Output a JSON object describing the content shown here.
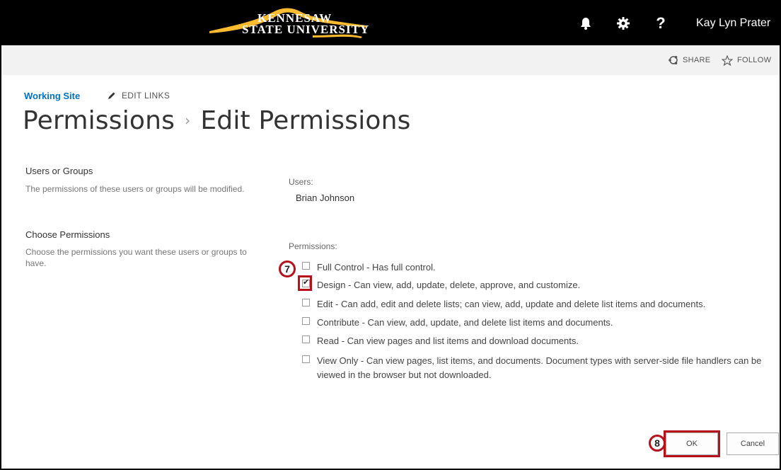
{
  "header": {
    "logo_line1": "KENNESAW",
    "logo_line2": "STATE UNIVERSITY",
    "user_name": "Kay Lyn Prater",
    "icons": [
      "bell-icon",
      "gear-icon",
      "help-icon"
    ]
  },
  "ribbon": {
    "share_label": "SHARE",
    "follow_label": "FOLLOW"
  },
  "breadcrumb": {
    "site_link": "Working Site",
    "edit_links_label": "EDIT LINKS"
  },
  "title": {
    "parent": "Permissions",
    "separator": "›",
    "current": "Edit Permissions"
  },
  "users_section": {
    "title": "Users or Groups",
    "description": "The permissions of these users or groups will be modified.",
    "label": "Users:",
    "value": "Brian Johnson"
  },
  "permissions_section": {
    "title": "Choose Permissions",
    "description": "Choose the permissions you want these users or groups to have.",
    "label": "Permissions:",
    "options": [
      {
        "text": "Full Control - Has full control.",
        "checked": false
      },
      {
        "text": "Design - Can view, add, update, delete, approve, and customize.",
        "checked": true
      },
      {
        "text": "Edit - Can add, edit and delete lists; can view, add, update and delete list items and documents.",
        "checked": false
      },
      {
        "text": "Contribute - Can view, add, update, and delete list items and documents.",
        "checked": false
      },
      {
        "text": "Read - Can view pages and list items and download documents.",
        "checked": false
      },
      {
        "text": "View Only - Can view pages, list items, and documents. Document types with server-side file handlers can be viewed in the browser but not downloaded.",
        "checked": false
      }
    ]
  },
  "buttons": {
    "ok_label": "OK",
    "cancel_label": "Cancel"
  },
  "callouts": {
    "step7": "7",
    "step8": "8"
  },
  "colors": {
    "suite_bar": "#000000",
    "ribbon": "#f2f2f2",
    "link": "#0072c6",
    "callout": "#b5121b",
    "logo_gold": "#fdbb30"
  }
}
